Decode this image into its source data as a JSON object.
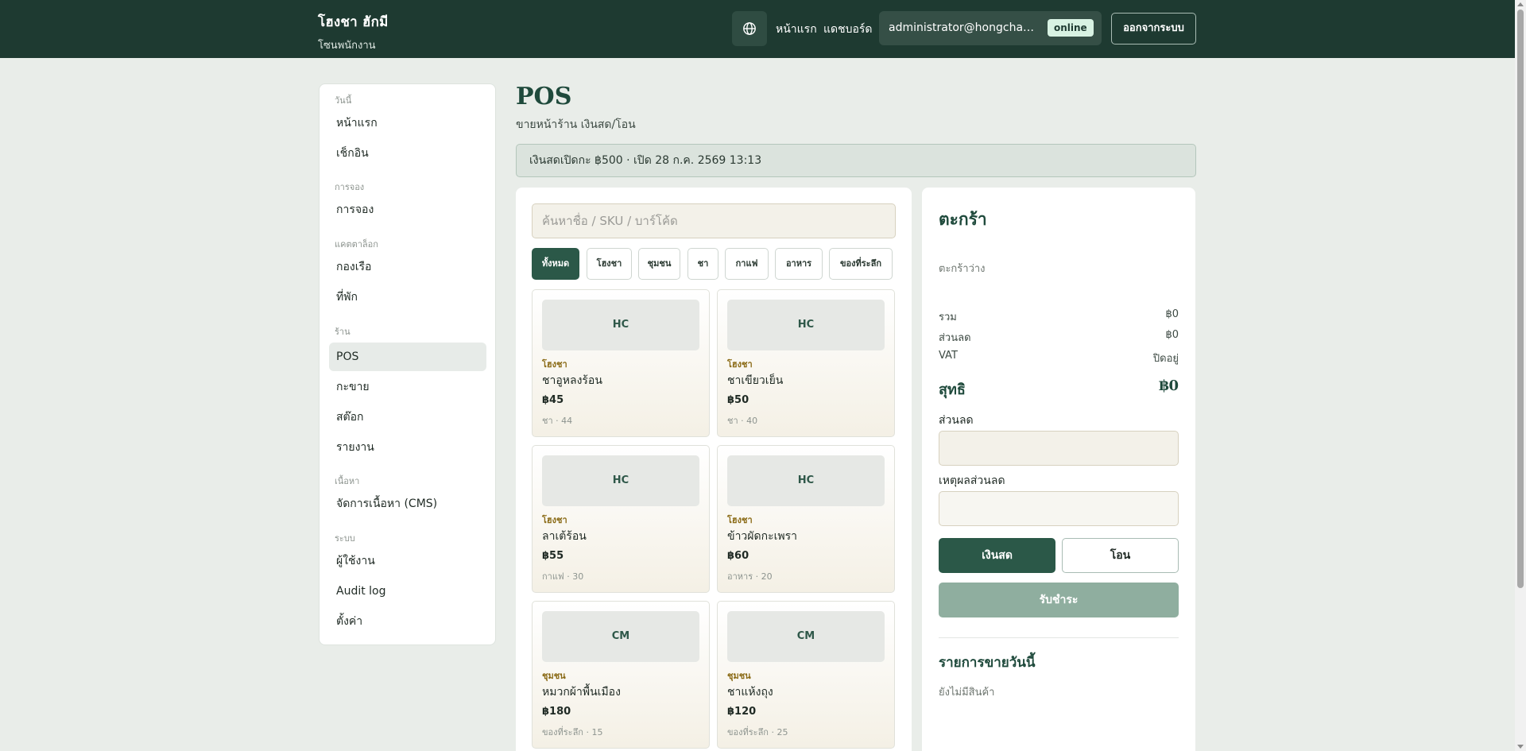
{
  "header": {
    "brand_name": "โฮงชา ฮักมี",
    "brand_sub": "โซนพนักงาน",
    "nav": [
      "หน้าแรก",
      "แดชบอร์ด"
    ],
    "user_email": "administrator@hongchahug...",
    "status_badge": "online",
    "logout_label": "ออกจากระบบ"
  },
  "sidebar": {
    "sections": [
      {
        "title": "วันนี้",
        "items": [
          "หน้าแรก",
          "เช็กอิน"
        ]
      },
      {
        "title": "การจอง",
        "items": [
          "การจอง"
        ]
      },
      {
        "title": "แคตตาล็อก",
        "items": [
          "กองเรือ",
          "ที่พัก"
        ]
      },
      {
        "title": "ร้าน",
        "items": [
          "POS",
          "กะขาย",
          "สต๊อก",
          "รายงาน"
        ]
      },
      {
        "title": "เนื้อหา",
        "items": [
          "จัดการเนื้อหา (CMS)"
        ]
      },
      {
        "title": "ระบบ",
        "items": [
          "ผู้ใช้งาน",
          "Audit log",
          "ตั้งค่า"
        ]
      }
    ],
    "active_item": "POS"
  },
  "page": {
    "title": "POS",
    "subtitle": "ขายหน้าร้าน เงินสด/โอน",
    "cash_banner": "เงินสดเปิดกะ ฿500 · เปิด 28 ก.ค. 2569 13:13"
  },
  "products": {
    "search_placeholder": "ค้นหาชื่อ / SKU / บาร์โค้ด",
    "filters": [
      "ทั้งหมด",
      "โฮงชา",
      "ชุมชน",
      "ชา",
      "กาแฟ",
      "อาหาร",
      "ของที่ระลึก"
    ],
    "active_filter": "ทั้งหมด",
    "items": [
      {
        "thumb": "HC",
        "category": "โฮงชา",
        "name": "ชาอูหลงร้อน",
        "price": "฿45",
        "meta": "ชา · 44"
      },
      {
        "thumb": "HC",
        "category": "โฮงชา",
        "name": "ชาเขียวเย็น",
        "price": "฿50",
        "meta": "ชา · 40"
      },
      {
        "thumb": "HC",
        "category": "โฮงชา",
        "name": "ลาเต้ร้อน",
        "price": "฿55",
        "meta": "กาแฟ · 30"
      },
      {
        "thumb": "HC",
        "category": "โฮงชา",
        "name": "ข้าวผัดกะเพรา",
        "price": "฿60",
        "meta": "อาหาร · 20"
      },
      {
        "thumb": "CM",
        "category": "ชุมชน",
        "name": "หมวกผ้าพื้นเมือง",
        "price": "฿180",
        "meta": "ของที่ระลึก · 15"
      },
      {
        "thumb": "CM",
        "category": "ชุมชน",
        "name": "ชาแห้งถุง",
        "price": "฿120",
        "meta": "ของที่ระลึก · 25"
      }
    ]
  },
  "cart": {
    "title": "ตะกร้า",
    "empty_text": "ตะกร้าว่าง",
    "subtotal_label": "รวม",
    "subtotal_value": "฿0",
    "discount_label": "ส่วนลด",
    "discount_value": "฿0",
    "vat_label": "VAT",
    "vat_value": "ปิดอยู่",
    "net_label": "สุทธิ",
    "net_value": "฿0",
    "discount_field_label": "ส่วนลด",
    "discount_reason_label": "เหตุผลส่วนลด",
    "cash_label": "เงินสด",
    "transfer_label": "โอน",
    "checkout_label": "รับชำระ",
    "sales_title": "รายการขายวันนี้",
    "sales_empty": "ยังไม่มีสินค้า"
  },
  "icons": {
    "language": "globe-icon"
  },
  "colors": {
    "header_bg": "#1e3a31",
    "accent": "#2b5848",
    "checkout_disabled": "#8fae9f",
    "category_text": "#8a6a15"
  }
}
